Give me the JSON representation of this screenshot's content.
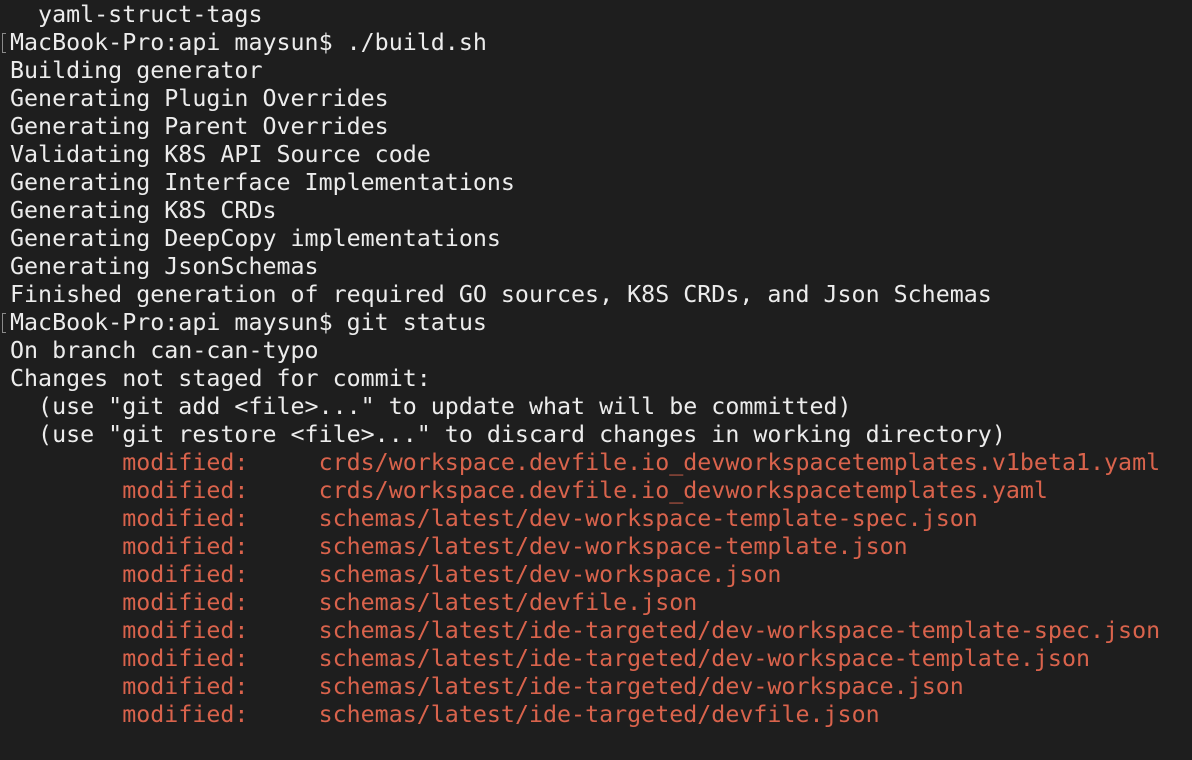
{
  "terminal": {
    "lines": [
      {
        "text": "  yaml-struct-tags",
        "kind": "output"
      },
      {
        "text": "MacBook-Pro:api maysun$ ./build.sh",
        "kind": "prompt"
      },
      {
        "text": "Building generator",
        "kind": "output"
      },
      {
        "text": "Generating Plugin Overrides",
        "kind": "output"
      },
      {
        "text": "Generating Parent Overrides",
        "kind": "output"
      },
      {
        "text": "Validating K8S API Source code",
        "kind": "output"
      },
      {
        "text": "Generating Interface Implementations",
        "kind": "output"
      },
      {
        "text": "Generating K8S CRDs",
        "kind": "output"
      },
      {
        "text": "Generating DeepCopy implementations",
        "kind": "output"
      },
      {
        "text": "Generating JsonSchemas",
        "kind": "output"
      },
      {
        "text": "Finished generation of required GO sources, K8S CRDs, and Json Schemas",
        "kind": "output"
      },
      {
        "text": "MacBook-Pro:api maysun$ git status",
        "kind": "prompt"
      },
      {
        "text": "On branch can-can-typo",
        "kind": "output"
      },
      {
        "text": "Changes not staged for commit:",
        "kind": "output"
      },
      {
        "text": "  (use \"git add <file>...\" to update what will be committed)",
        "kind": "output"
      },
      {
        "text": "  (use \"git restore <file>...\" to discard changes in working directory)",
        "kind": "output"
      }
    ],
    "modified": [
      {
        "label": "modified:",
        "path": "crds/workspace.devfile.io_devworkspacetemplates.v1beta1.yaml"
      },
      {
        "label": "modified:",
        "path": "crds/workspace.devfile.io_devworkspacetemplates.yaml"
      },
      {
        "label": "modified:",
        "path": "schemas/latest/dev-workspace-template-spec.json"
      },
      {
        "label": "modified:",
        "path": "schemas/latest/dev-workspace-template.json"
      },
      {
        "label": "modified:",
        "path": "schemas/latest/dev-workspace.json"
      },
      {
        "label": "modified:",
        "path": "schemas/latest/devfile.json"
      },
      {
        "label": "modified:",
        "path": "schemas/latest/ide-targeted/dev-workspace-template-spec.json"
      },
      {
        "label": "modified:",
        "path": "schemas/latest/ide-targeted/dev-workspace-template.json"
      },
      {
        "label": "modified:",
        "path": "schemas/latest/ide-targeted/dev-workspace.json"
      },
      {
        "label": "modified:",
        "path": "schemas/latest/ide-targeted/devfile.json"
      }
    ],
    "colors": {
      "background": "#1e1e1e",
      "text": "#ececec",
      "modified": "#d9634c"
    }
  }
}
